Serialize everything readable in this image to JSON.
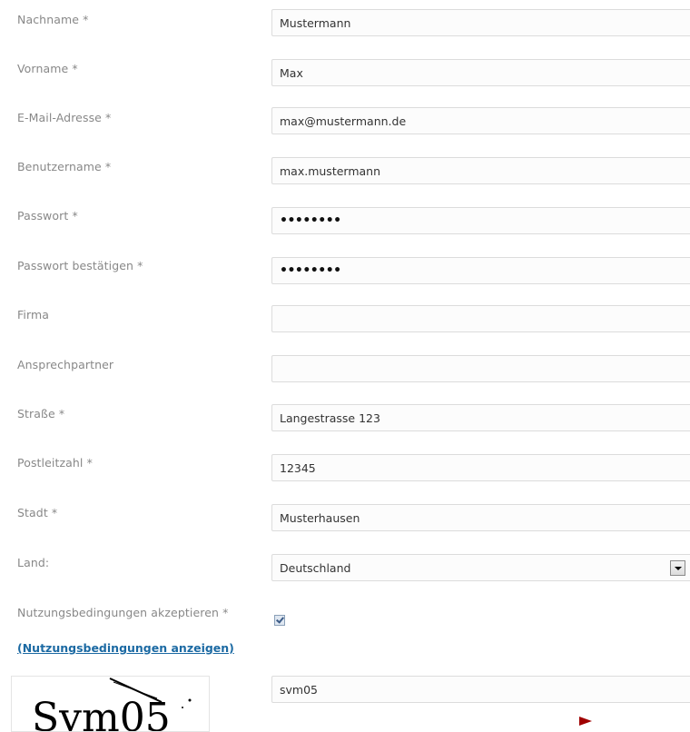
{
  "form": {
    "fields": [
      {
        "label": "Nachname *",
        "value": "Mustermann"
      },
      {
        "label": "Vorname *",
        "value": "Max"
      },
      {
        "label": "E-Mail-Adresse *",
        "value": "max@mustermann.de"
      },
      {
        "label": "Benutzername *",
        "value": "max.mustermann"
      },
      {
        "label": "Passwort *",
        "value": "••••••••"
      },
      {
        "label": "Passwort bestätigen *",
        "value": "••••••••"
      },
      {
        "label": "Firma",
        "value": ""
      },
      {
        "label": "Ansprechpartner",
        "value": ""
      },
      {
        "label": "Straße *",
        "value": "Langestrasse 123"
      },
      {
        "label": "Postleitzahl *",
        "value": "12345"
      },
      {
        "label": "Stadt *",
        "value": "Musterhausen"
      },
      {
        "label": "Land:",
        "value": "Deutschland"
      }
    ],
    "terms": {
      "label": "Nutzungsbedingungen akzeptieren *",
      "checked": true,
      "link": "(Nutzungsbedingungen anzeigen)"
    },
    "captcha": {
      "image_text": "Svm05",
      "input_value": "svm05"
    }
  },
  "colors": {
    "label": "#888888",
    "link": "#1c6aa3",
    "arrow": "#a00000"
  },
  "icons": {
    "select": "chevron-down-icon",
    "checkbox": "checkmark-icon",
    "pointer": "arrow-right-icon"
  }
}
